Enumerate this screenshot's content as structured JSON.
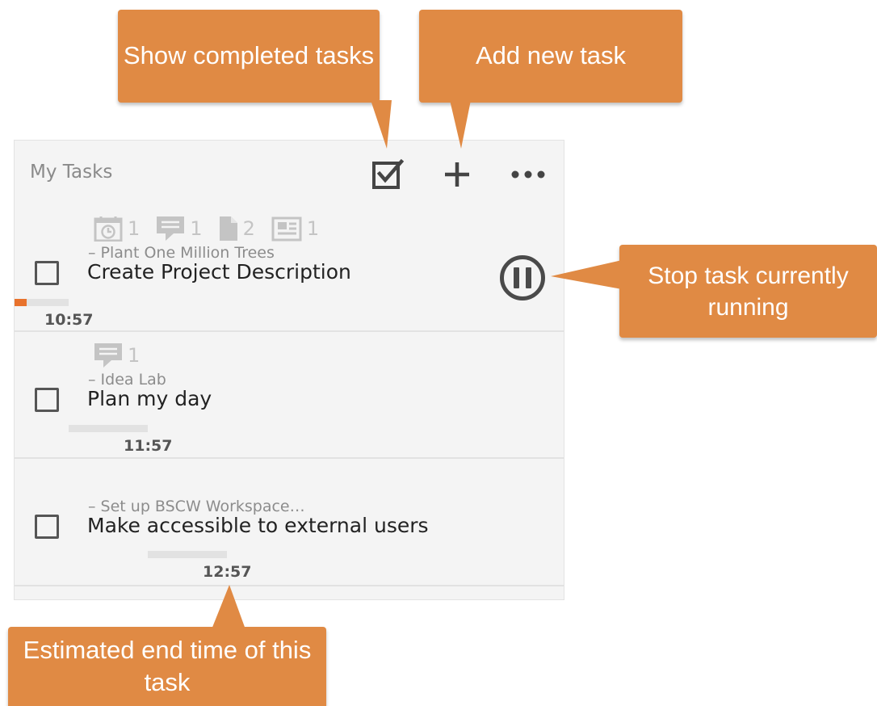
{
  "widget": {
    "title": "My Tasks",
    "header_icons": [
      "checkbox-checked-icon",
      "plus-icon",
      "more-icon"
    ]
  },
  "tasks": [
    {
      "project": "– Plant One Million Trees",
      "title": "Create Project Description",
      "meta": [
        {
          "icon": "alarm-icon",
          "count": "1"
        },
        {
          "icon": "comment-icon",
          "count": "1"
        },
        {
          "icon": "document-icon",
          "count": "2"
        },
        {
          "icon": "note-icon",
          "count": "1"
        }
      ],
      "progress": 0.22,
      "end_time": "10:57",
      "running": true,
      "completed": false
    },
    {
      "project": "– Idea Lab",
      "title": "Plan my day",
      "meta": [
        {
          "icon": "comment-icon",
          "count": "1"
        }
      ],
      "progress": 0,
      "end_time": "11:57",
      "running": false,
      "completed": false
    },
    {
      "project": "– Set up BSCW Workspace…",
      "title": "Make accessible to external users",
      "meta": [],
      "progress": 0,
      "end_time": "12:57",
      "running": false,
      "completed": false
    }
  ],
  "callouts": {
    "show_completed": "Show completed tasks",
    "add_task": "Add new task",
    "stop_task": "Stop task currently running",
    "end_time": "Estimated end time of this task"
  },
  "colors": {
    "accent": "#e8722c",
    "callout": "#e08a44",
    "panel_bg": "#f4f4f4"
  }
}
